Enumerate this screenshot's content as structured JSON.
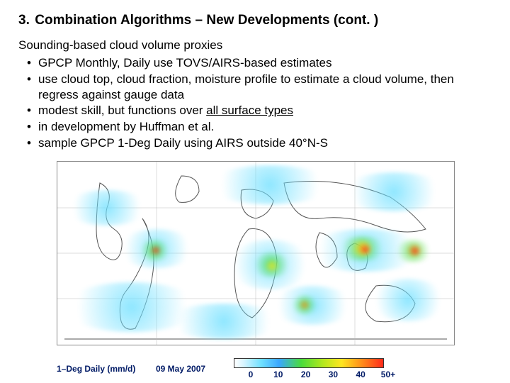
{
  "title": {
    "num": "3.",
    "text": "Combination Algorithms – New Developments (cont. )"
  },
  "subhead": "Sounding-based cloud volume proxies",
  "bullets": [
    {
      "text": "GPCP Monthly, Daily use TOVS/AIRS-based estimates"
    },
    {
      "text": "use cloud top, cloud fraction, moisture profile to estimate a cloud volume, then",
      "line2": "regress against gauge data"
    },
    {
      "parts": [
        "modest skill, but functions over ",
        {
          "u": "all surface types"
        }
      ]
    },
    {
      "text": "in development by Huffman et al."
    },
    {
      "text": "sample GPCP 1-Deg Daily using AIRS outside 40°N-S"
    }
  ],
  "legend": {
    "product": "1–Deg Daily (mm/d)",
    "date": "09 May 2007",
    "ticks": [
      "0",
      "10",
      "20",
      "30",
      "40",
      "50+"
    ]
  }
}
